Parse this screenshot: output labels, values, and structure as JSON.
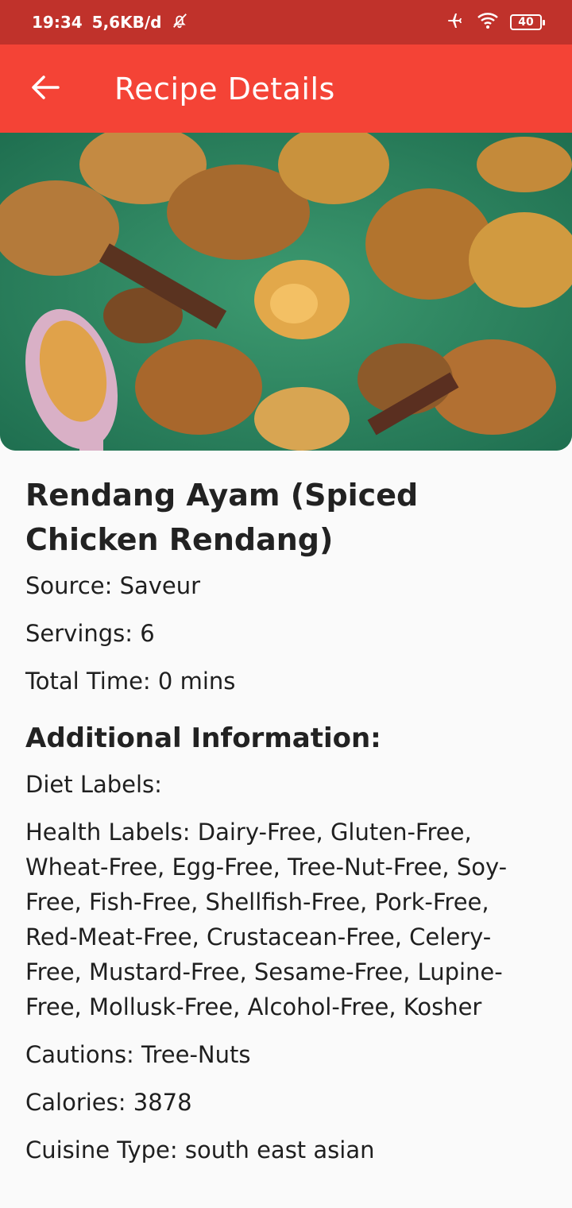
{
  "status_bar": {
    "time": "19:34",
    "speed": "5,6KB/d",
    "battery": "40",
    "icons": [
      "mute-icon",
      "airplane-icon",
      "wifi-icon",
      "battery-icon"
    ]
  },
  "app_bar": {
    "title": "Recipe Details",
    "back_icon": "arrow-left-icon",
    "color": "#f44336"
  },
  "recipe": {
    "title": "Rendang Ayam (Spiced Chicken Rendang)",
    "source": "Source: Saveur",
    "servings": "Servings: 6",
    "total_time": "Total Time: 0 mins",
    "additional_heading": "Additional Information:",
    "diet_labels": "Diet Labels:",
    "health_labels": "Health Labels: Dairy-Free, Gluten-Free, Wheat-Free, Egg-Free, Tree-Nut-Free, Soy-Free, Fish-Free, Shellfish-Free, Pork-Free, Red-Meat-Free, Crustacean-Free, Celery-Free, Mustard-Free, Sesame-Free, Lupine-Free, Mollusk-Free, Alcohol-Free, Kosher",
    "cautions": "Cautions: Tree-Nuts",
    "calories": "Calories: 3878",
    "cuisine": "Cuisine Type: south east asian"
  }
}
